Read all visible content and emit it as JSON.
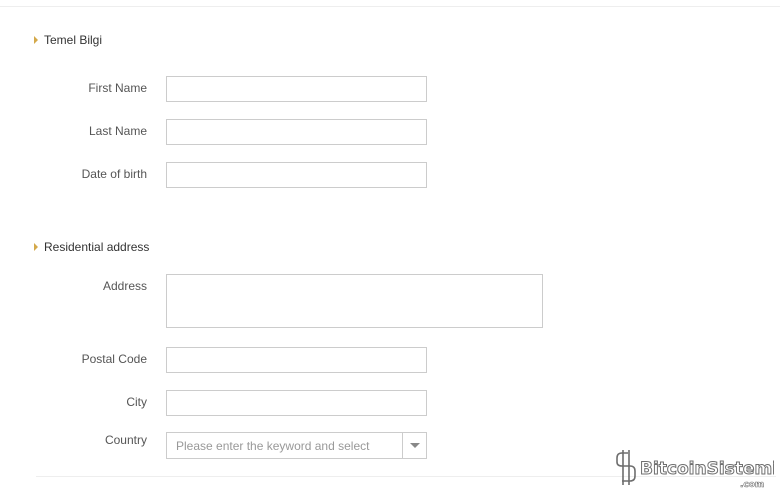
{
  "sections": {
    "basic_info": {
      "title": "Temel Bilgi"
    },
    "address": {
      "title": "Residential address"
    }
  },
  "fields": {
    "first_name": {
      "label": "First Name",
      "value": ""
    },
    "last_name": {
      "label": "Last Name",
      "value": ""
    },
    "date_of_birth": {
      "label": "Date of birth",
      "value": ""
    },
    "address": {
      "label": "Address",
      "value": ""
    },
    "postal_code": {
      "label": "Postal Code",
      "value": ""
    },
    "city": {
      "label": "City",
      "value": ""
    },
    "country": {
      "label": "Country",
      "placeholder": "Please enter the keyword and select"
    }
  },
  "watermark": {
    "text": "BitcoinSistemi",
    "suffix": ".com"
  },
  "colors": {
    "accent": "#d4a94a",
    "border": "#cccccc"
  }
}
